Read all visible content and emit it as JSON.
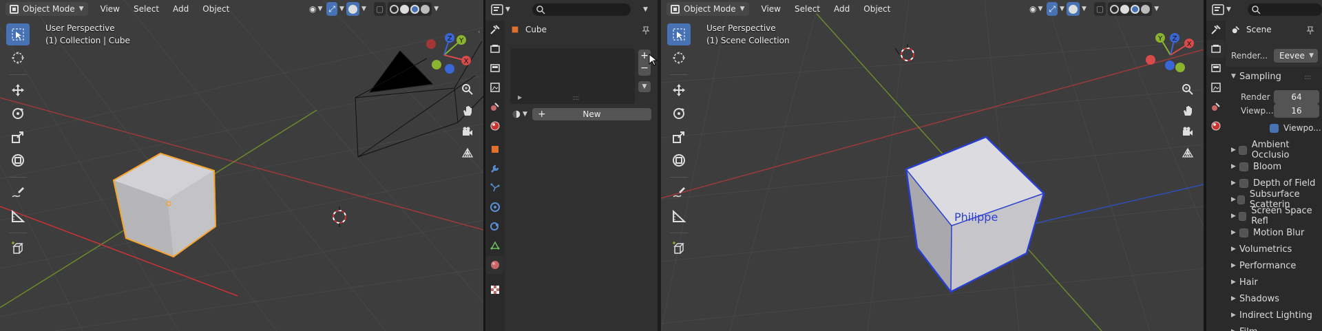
{
  "left_viewport": {
    "mode_label": "Object Mode",
    "menu": [
      "View",
      "Select",
      "Add",
      "Object"
    ],
    "info_line1": "User Perspective",
    "info_line2": "(1) Collection | Cube"
  },
  "material_panel": {
    "object_name": "Cube",
    "new_button_label": "New",
    "search_placeholder": ""
  },
  "right_viewport": {
    "mode_label": "Object Mode",
    "menu": [
      "View",
      "Select",
      "Add",
      "Object"
    ],
    "info_line1": "User Perspective",
    "info_line2": "(1) Scene Collection",
    "cube_label": "Philippe"
  },
  "render_panel": {
    "scene_name": "Scene",
    "render_engine_label": "Render...",
    "render_engine_value": "Eevee",
    "sampling_title": "Sampling",
    "render_label": "Render",
    "render_samples": "64",
    "viewport_label": "Viewp...",
    "viewport_samples": "16",
    "viewport_denoise_label": "Viewpo...",
    "sections": [
      "Ambient Occlusio",
      "Bloom",
      "Depth of Field",
      "Subsurface Scatterin",
      "Screen Space Refl",
      "Motion Blur",
      "Volumetrics",
      "Performance",
      "Hair",
      "Shadows",
      "Indirect Lighting",
      "Film"
    ]
  },
  "gizmo_axes": [
    "X",
    "Y",
    "Z"
  ],
  "colors": {
    "accent": "#4772b3",
    "x_axis": "#d84b4b",
    "y_axis": "#8ab32f",
    "z_axis": "#3b66d6",
    "selection": "#f5a430"
  },
  "icons": [
    "object-mode-icon",
    "search-icon",
    "pin-icon",
    "plus-icon",
    "minus-icon",
    "material-sphere-icon",
    "zoom-icon",
    "hand-icon",
    "camera-icon",
    "grid-icon",
    "cursor-icon",
    "move-icon",
    "rotate-icon",
    "scale-icon",
    "transform-icon",
    "annotate-icon",
    "measure-icon",
    "add-cube-icon"
  ]
}
